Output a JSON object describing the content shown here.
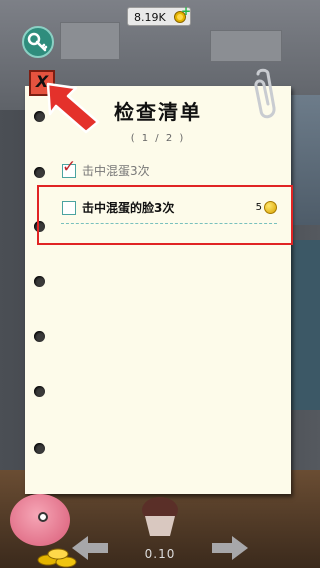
{
  "top": {
    "coins": "8.19K",
    "plus_label": "+"
  },
  "checklist": {
    "close_label": "X",
    "title": "检查清单",
    "page": "( 1 / 2 )",
    "tasks": [
      {
        "label": "击中混蛋3次",
        "status": "done"
      },
      {
        "label": "击中混蛋的脸3次",
        "status": "pending",
        "reward": "5"
      }
    ]
  },
  "bottom": {
    "value": "0.10"
  },
  "colors": {
    "highlight": "#e02424",
    "check": "#c1272d",
    "paper": "#fdfbea"
  }
}
